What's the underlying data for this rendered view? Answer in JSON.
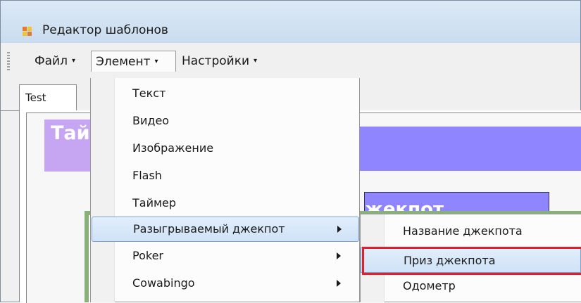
{
  "window": {
    "title": "Редактор шаблонов",
    "icon": "app-window-icon"
  },
  "menubar": {
    "items": [
      {
        "label": "Файл",
        "arrow": "▾"
      },
      {
        "label": "Элемент",
        "arrow": "▾"
      },
      {
        "label": "Настройки",
        "arrow": "▾"
      }
    ]
  },
  "tabs": [
    {
      "label": "Test"
    }
  ],
  "canvas": {
    "timer_text": "Тай",
    "jackpot_text": "жекпот"
  },
  "dropdown": {
    "items": [
      {
        "label": "Текст",
        "has_submenu": false
      },
      {
        "label": "Видео",
        "has_submenu": false
      },
      {
        "label": "Изображение",
        "has_submenu": false
      },
      {
        "label": "Flash",
        "has_submenu": false
      },
      {
        "label": "Таймер",
        "has_submenu": false
      },
      {
        "label": "Разыгрываемый джекпот",
        "has_submenu": true,
        "highlighted": true
      },
      {
        "label": "Poker",
        "has_submenu": true
      },
      {
        "label": "Cowabingo",
        "has_submenu": true
      }
    ]
  },
  "submenu": {
    "items": [
      {
        "label": "Название джекпота"
      },
      {
        "label": "Приз джекпота",
        "highlighted": true
      },
      {
        "label": "Одометр"
      }
    ]
  },
  "colors": {
    "highlight": "#cfe2f7",
    "annotation_red": "#e0202e",
    "banner_purple": "#8f86ff",
    "timer_lilac": "#c6a6f2",
    "frame_green": "#88b17a"
  }
}
